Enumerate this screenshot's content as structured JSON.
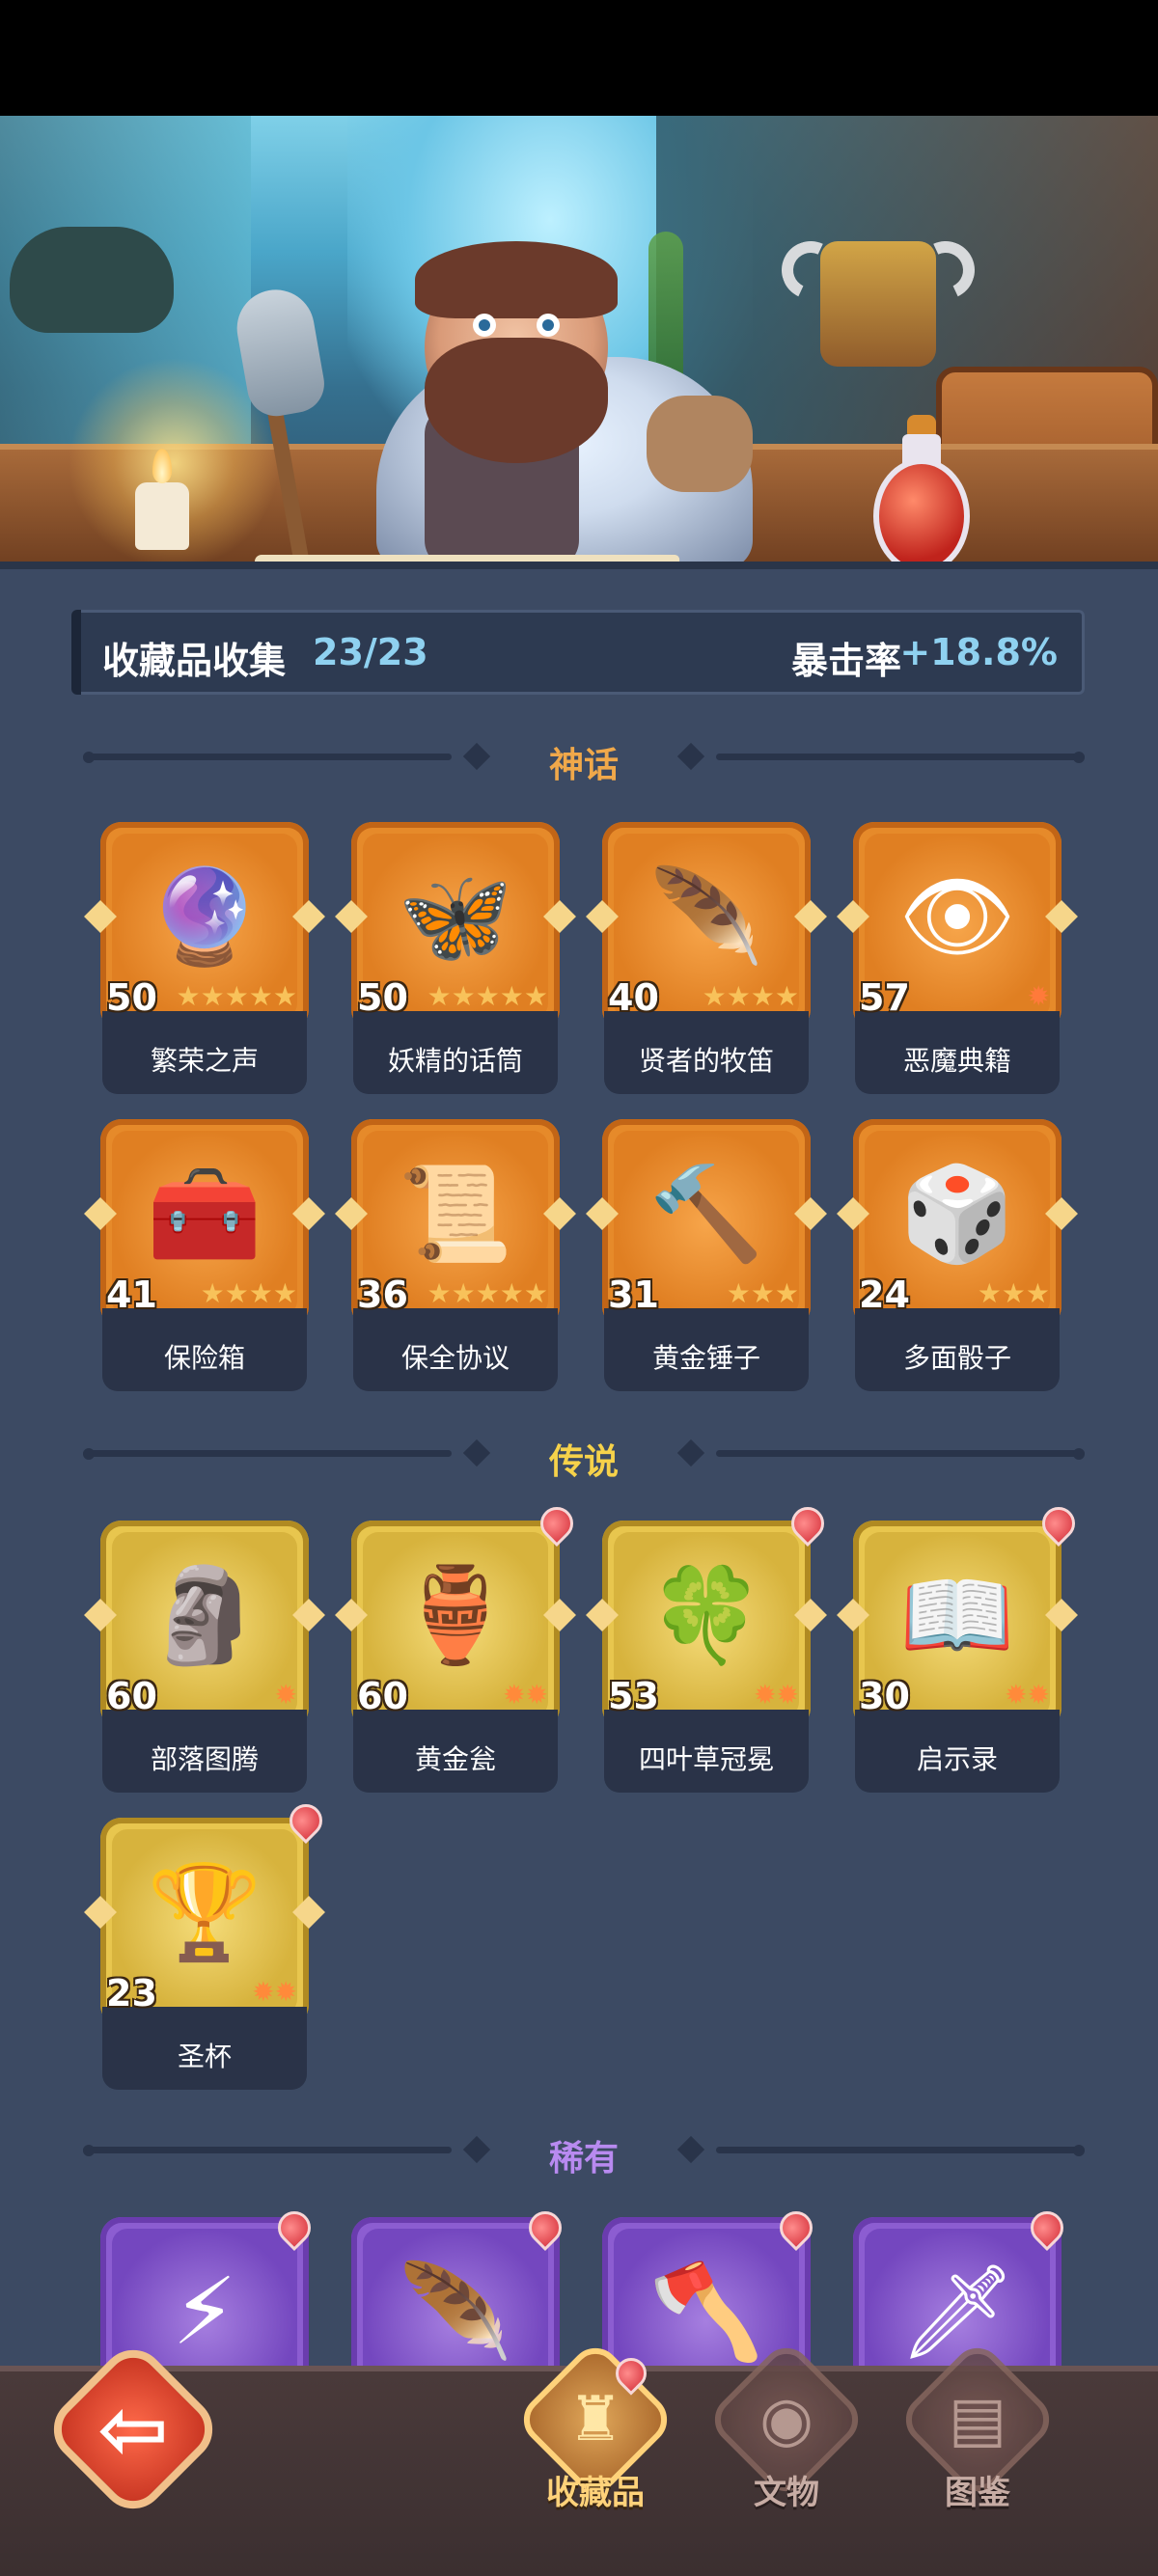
{
  "summary": {
    "title": "收藏品收集",
    "count": "23/23",
    "crit_label": "暴击率",
    "crit_value": "+18.8%"
  },
  "sections": {
    "mythic": "神话",
    "legendary": "传说",
    "rare": "稀有"
  },
  "colors": {
    "mythic_title": "#f0a84a",
    "legendary_title": "#f6d24a",
    "rare_title": "#b88af0",
    "accent_blue": "#8fd1f0"
  },
  "mythic_items": [
    {
      "name": "繁荣之声",
      "level": "50",
      "stars": "★★★★★",
      "icon": "blue-spirit-orb-icon",
      "glyph": "🔮"
    },
    {
      "name": "妖精的话筒",
      "level": "50",
      "stars": "★★★★★",
      "icon": "fairy-microphone-icon",
      "glyph": "🦋"
    },
    {
      "name": "贤者的牧笛",
      "level": "40",
      "stars": "★★★★",
      "icon": "sage-flute-icon",
      "glyph": "🪶"
    },
    {
      "name": "恶魔典籍",
      "level": "57",
      "stars": "✹",
      "icon": "demon-tome-icon",
      "glyph": "👁"
    },
    {
      "name": "保险箱",
      "level": "41",
      "stars": "★★★★",
      "icon": "treasure-safe-icon",
      "glyph": "🧰"
    },
    {
      "name": "保全协议",
      "level": "36",
      "stars": "★★★★★",
      "icon": "contract-scroll-icon",
      "glyph": "📜"
    },
    {
      "name": "黄金锤子",
      "level": "31",
      "stars": "★★★",
      "icon": "golden-hammer-icon",
      "glyph": "🔨"
    },
    {
      "name": "多面骰子",
      "level": "24",
      "stars": "★★★",
      "icon": "polyhedral-dice-icon",
      "glyph": "🎲"
    }
  ],
  "legendary_items": [
    {
      "name": "部落图腾",
      "level": "60",
      "stars": "✹",
      "icon": "tribal-totem-icon",
      "glyph": "🗿"
    },
    {
      "name": "黄金瓮",
      "level": "60",
      "stars": "✹✹",
      "icon": "golden-urn-icon",
      "glyph": "🏺"
    },
    {
      "name": "四叶草冠冕",
      "level": "53",
      "stars": "✹✹",
      "icon": "clover-crown-icon",
      "glyph": "🍀"
    },
    {
      "name": "启示录",
      "level": "30",
      "stars": "✹✹",
      "icon": "revelation-book-icon",
      "glyph": "📖"
    },
    {
      "name": "圣杯",
      "level": "23",
      "stars": "✹✹",
      "icon": "holy-grail-icon",
      "glyph": "🏆"
    }
  ],
  "rare_items": [
    {
      "icon": "lightning-gem-icon",
      "glyph": "⚡"
    },
    {
      "icon": "phoenix-feather-icon",
      "glyph": "🪶"
    },
    {
      "icon": "stone-axe-icon",
      "glyph": "🪓"
    },
    {
      "icon": "ice-sword-icon",
      "glyph": "🗡"
    }
  ],
  "nav": {
    "back_icon": "⇦",
    "tabs": [
      {
        "label": "收藏品",
        "icon": "collection-icon",
        "glyph": "♜"
      },
      {
        "label": "文物",
        "icon": "artifact-eye-icon",
        "glyph": "◉"
      },
      {
        "label": "图鉴",
        "icon": "codex-book-icon",
        "glyph": "▤"
      }
    ]
  }
}
